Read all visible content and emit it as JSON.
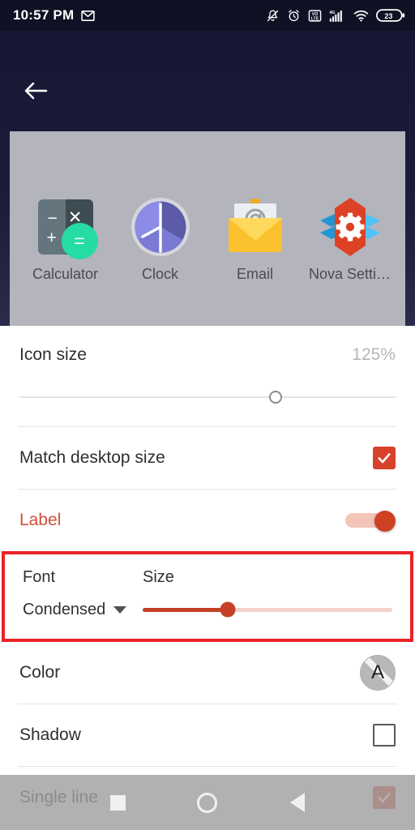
{
  "status_bar": {
    "time": "10:57 PM",
    "notification_icons": [
      "gmail-icon"
    ],
    "system_icons": [
      "bell-muted-icon",
      "alarm-clock-icon",
      "volte-icon",
      "signal-4g-icon",
      "wifi-icon"
    ],
    "battery_percent": "23",
    "volte_label": "VO LTE",
    "network_label": "4G"
  },
  "header": {
    "back_label": "←"
  },
  "preview": {
    "background_color": "#b4b4bd",
    "apps": [
      {
        "label": "Calculator",
        "icon": "calculator-icon"
      },
      {
        "label": "Clock",
        "icon": "clock-icon"
      },
      {
        "label": "Email",
        "icon": "email-icon"
      },
      {
        "label": "Nova Setti…",
        "icon": "nova-settings-icon"
      }
    ]
  },
  "settings": {
    "icon_size": {
      "label": "Icon size",
      "value": "125%",
      "slider_position_percent": 68,
      "enabled": false
    },
    "match_desktop_size": {
      "label": "Match desktop size",
      "checked": true
    },
    "label_toggle": {
      "label": "Label",
      "enabled": true,
      "accent_color": "#cf4124"
    },
    "font_size_group": {
      "highlight_color": "#ea2427",
      "font_title": "Font",
      "size_title": "Size",
      "font_value": "Condensed",
      "size_slider_position_percent": 34
    },
    "color": {
      "label": "Color",
      "swatch_letter": "A"
    },
    "shadow": {
      "label": "Shadow",
      "checked": false
    },
    "single_line": {
      "label": "Single line",
      "checked": true
    }
  },
  "nav_bar": {
    "buttons": [
      "recents-square-icon",
      "home-circle-icon",
      "back-triangle-icon"
    ]
  }
}
